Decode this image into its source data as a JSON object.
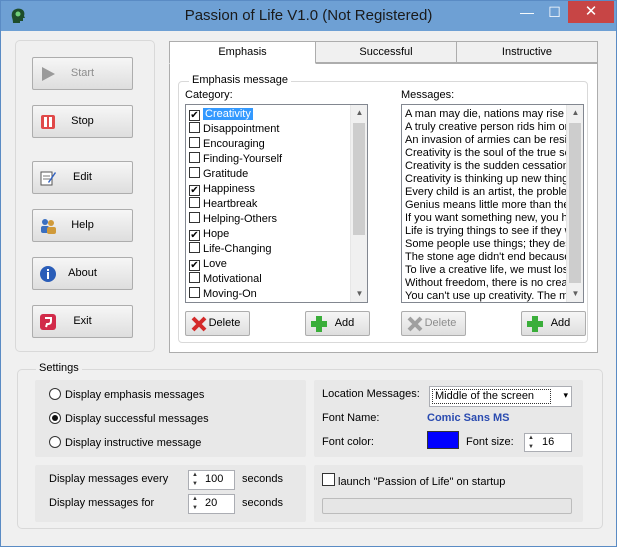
{
  "window": {
    "title": "Passion of Life V1.0 (Not Registered)",
    "minimize": "—",
    "maximize": "☐",
    "close": "✕"
  },
  "sidebar": {
    "start": "Start",
    "stop": "Stop",
    "edit": "Edit",
    "help": "Help",
    "about": "About",
    "exit": "Exit"
  },
  "tabs": [
    "Emphasis",
    "Successful",
    "Instructive"
  ],
  "emphasis": {
    "group_label": "Emphasis message",
    "category_label": "Category:",
    "messages_label": "Messages:",
    "categories": [
      {
        "label": "Creativity",
        "checked": true,
        "selected": true
      },
      {
        "label": "Disappointment",
        "checked": false
      },
      {
        "label": "Encouraging",
        "checked": false
      },
      {
        "label": "Finding-Yourself",
        "checked": false
      },
      {
        "label": "Gratitude",
        "checked": false
      },
      {
        "label": "Happiness",
        "checked": true
      },
      {
        "label": "Heartbreak",
        "checked": false
      },
      {
        "label": "Helping-Others",
        "checked": false
      },
      {
        "label": "Hope",
        "checked": true
      },
      {
        "label": "Life-Changing",
        "checked": false
      },
      {
        "label": "Love",
        "checked": true
      },
      {
        "label": "Motivational",
        "checked": false
      },
      {
        "label": "Moving-On",
        "checked": false
      }
    ],
    "messages": [
      "A man may die, nations may rise ar",
      "A truly creative person rids him or h",
      "An invasion of armies can be resist",
      "Creativity is the soul of the true sch",
      "Creativity is the sudden cessation o",
      "Creativity is thinking up new things",
      "Every child is an artist, the problem",
      "Genius means little more than the f",
      "If you want something new, you ha",
      "Life is trying things to see if they w",
      "Some people use things; they dest",
      "The stone age didn't end because",
      "To live a creative life, we must lose",
      "Without freedom, there is no creati",
      "You can't use up creativity. The m"
    ],
    "delete_label": "Delete",
    "add_label": "Add",
    "delete2_label": "Delete",
    "add2_label": "Add"
  },
  "settings": {
    "label": "Settings",
    "radios": [
      {
        "label": "Display emphasis messages",
        "selected": false
      },
      {
        "label": "Display successful messages",
        "selected": true
      },
      {
        "label": "Display instructive message",
        "selected": false
      }
    ],
    "location_label": "Location Messages:",
    "location_value": "Middle of the screen",
    "font_name_label": "Font Name:",
    "font_name_value": "Comic Sans MS",
    "font_color_label": "Font color:",
    "font_color": "#0000ff",
    "font_size_label": "Font size:",
    "font_size_value": "16",
    "every_label": "Display messages every",
    "every_value": "100",
    "every_unit": "seconds",
    "for_label": "Display messages for",
    "for_value": "20",
    "for_unit": "seconds",
    "startup_label": "launch \"Passion of Life\" on startup"
  },
  "colors": {
    "titlebar": "#6ea0d4",
    "selection": "#3399ff",
    "link_blue": "#2a4bb0",
    "close_red": "#c74545"
  }
}
